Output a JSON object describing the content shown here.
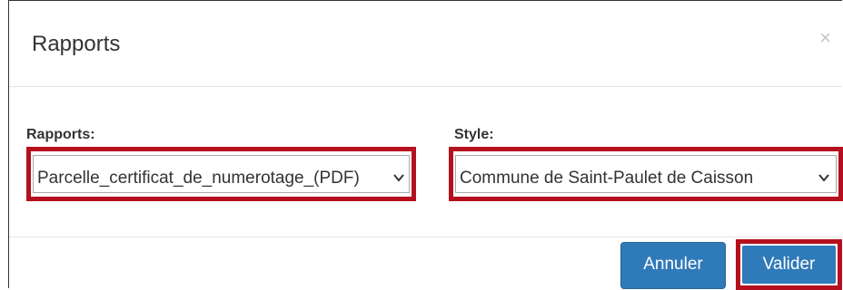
{
  "dialog": {
    "title": "Rapports",
    "close_glyph": "×"
  },
  "form": {
    "rapports": {
      "label": "Rapports:",
      "selected": "Parcelle_certificat_de_numerotage_(PDF)",
      "highlighted": true
    },
    "style": {
      "label": "Style:",
      "selected": "Commune de Saint-Paulet de Caisson",
      "highlighted": true
    }
  },
  "footer": {
    "cancel_label": "Annuler",
    "validate_label": "Valider",
    "validate_highlighted": true
  },
  "colors": {
    "highlight": "#b5101e",
    "primary_button": "#2f7ab9",
    "close_icon": "#c4c4c4"
  },
  "icons": {
    "close": "close-icon",
    "dropdown": "chevron-down-icon"
  }
}
